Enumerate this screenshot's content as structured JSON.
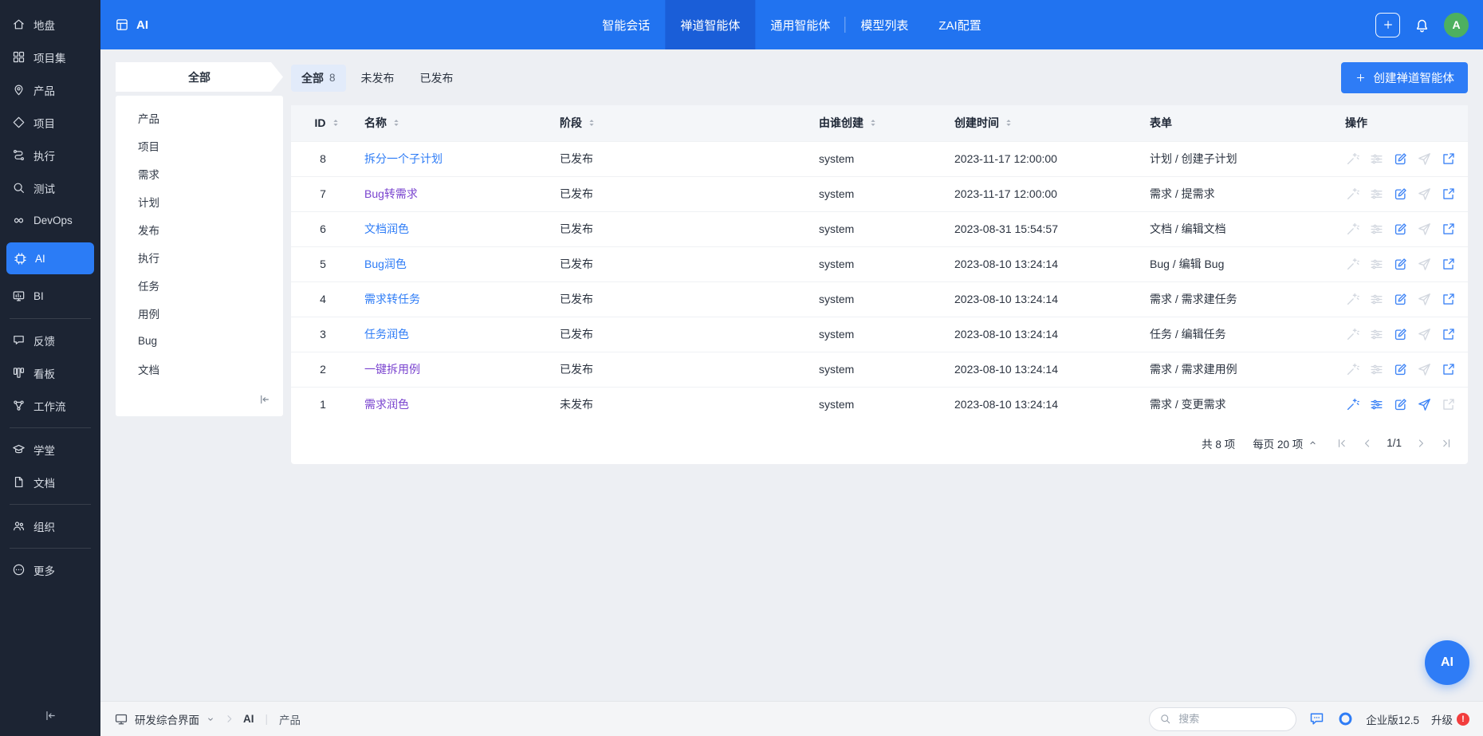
{
  "app": {
    "accent": "#2e7cf6",
    "header_blue": "#2173f0",
    "sidebar_dark": "#1c2433"
  },
  "sidebar": {
    "items": [
      {
        "label": "地盘",
        "icon": "home",
        "name": "sidebar-item-home"
      },
      {
        "label": "项目集",
        "icon": "grid4",
        "name": "sidebar-item-program"
      },
      {
        "label": "产品",
        "icon": "pin",
        "name": "sidebar-item-product"
      },
      {
        "label": "项目",
        "icon": "diamond",
        "name": "sidebar-item-project"
      },
      {
        "label": "执行",
        "icon": "route",
        "name": "sidebar-item-execution"
      },
      {
        "label": "测试",
        "icon": "search",
        "name": "sidebar-item-qa"
      },
      {
        "label": "DevOps",
        "icon": "infinity",
        "name": "sidebar-item-devops"
      },
      {
        "label": "AI",
        "icon": "ai-chip",
        "name": "sidebar-item-ai",
        "active": true
      },
      {
        "label": "BI",
        "icon": "bi",
        "name": "sidebar-item-bi"
      },
      {
        "label": "反馈",
        "icon": "bubble",
        "name": "sidebar-item-feedback",
        "divider_before": true
      },
      {
        "label": "看板",
        "icon": "kanban",
        "name": "sidebar-item-kanban"
      },
      {
        "label": "工作流",
        "icon": "flow",
        "name": "sidebar-item-workflow"
      },
      {
        "label": "学堂",
        "icon": "grad",
        "name": "sidebar-item-learn",
        "divider_before": true
      },
      {
        "label": "文档",
        "icon": "file",
        "name": "sidebar-item-doc"
      },
      {
        "label": "组织",
        "icon": "users",
        "name": "sidebar-item-org",
        "divider_before": true
      },
      {
        "label": "更多",
        "icon": "more",
        "name": "sidebar-item-more",
        "divider_before": true
      }
    ]
  },
  "header": {
    "app_label": "AI",
    "tabs": [
      {
        "label": "智能会话",
        "name": "tab-chat-session"
      },
      {
        "label": "禅道智能体",
        "name": "tab-zentao-agents",
        "active": true
      },
      {
        "label": "通用智能体",
        "name": "tab-general-agents",
        "divider_after": true
      },
      {
        "label": "模型列表",
        "name": "tab-model-list"
      },
      {
        "label": "ZAI配置",
        "name": "tab-zai-config"
      }
    ],
    "avatar_text": "A"
  },
  "filter_panel": {
    "title": "全部",
    "items": [
      {
        "label": "产品",
        "name": "filter-item-product"
      },
      {
        "label": "项目",
        "name": "filter-item-project"
      },
      {
        "label": "需求",
        "name": "filter-item-story"
      },
      {
        "label": "计划",
        "name": "filter-item-plan"
      },
      {
        "label": "发布",
        "name": "filter-item-release"
      },
      {
        "label": "执行",
        "name": "filter-item-execution"
      },
      {
        "label": "任务",
        "name": "filter-item-task"
      },
      {
        "label": "用例",
        "name": "filter-item-case"
      },
      {
        "label": "Bug",
        "name": "filter-item-bug"
      },
      {
        "label": "文档",
        "name": "filter-item-doc"
      }
    ]
  },
  "toolbar": {
    "tabs": [
      {
        "label": "全部",
        "count": "8",
        "active": true,
        "name": "status-tab-all"
      },
      {
        "label": "未发布",
        "name": "status-tab-unpublished"
      },
      {
        "label": "已发布",
        "name": "status-tab-published"
      }
    ],
    "create_button": "创建禅道智能体"
  },
  "table": {
    "columns": [
      {
        "label": "ID"
      },
      {
        "label": "名称"
      },
      {
        "label": "阶段"
      },
      {
        "label": "由谁创建"
      },
      {
        "label": "创建时间"
      },
      {
        "label": "表单"
      },
      {
        "label": "操作"
      }
    ],
    "rows": [
      {
        "id": "8",
        "name": "拆分一个子计划",
        "visited": false,
        "stage": "已发布",
        "creator": "system",
        "created": "2023-11-17 12:00:00",
        "form": "计划 / 创建子计划",
        "actions": {
          "wand": false,
          "config": false,
          "edit": true,
          "send": false,
          "open": true
        }
      },
      {
        "id": "7",
        "name": "Bug转需求",
        "visited": true,
        "stage": "已发布",
        "creator": "system",
        "created": "2023-11-17 12:00:00",
        "form": "需求 / 提需求",
        "actions": {
          "wand": false,
          "config": false,
          "edit": true,
          "send": false,
          "open": true
        }
      },
      {
        "id": "6",
        "name": "文档润色",
        "visited": false,
        "stage": "已发布",
        "creator": "system",
        "created": "2023-08-31 15:54:57",
        "form": "文档 / 编辑文档",
        "actions": {
          "wand": false,
          "config": false,
          "edit": true,
          "send": false,
          "open": true
        }
      },
      {
        "id": "5",
        "name": "Bug润色",
        "visited": false,
        "stage": "已发布",
        "creator": "system",
        "created": "2023-08-10 13:24:14",
        "form": "Bug / 编辑 Bug",
        "actions": {
          "wand": false,
          "config": false,
          "edit": true,
          "send": false,
          "open": true
        }
      },
      {
        "id": "4",
        "name": "需求转任务",
        "visited": false,
        "stage": "已发布",
        "creator": "system",
        "created": "2023-08-10 13:24:14",
        "form": "需求 / 需求建任务",
        "actions": {
          "wand": false,
          "config": false,
          "edit": true,
          "send": false,
          "open": true
        }
      },
      {
        "id": "3",
        "name": "任务润色",
        "visited": false,
        "stage": "已发布",
        "creator": "system",
        "created": "2023-08-10 13:24:14",
        "form": "任务 / 编辑任务",
        "actions": {
          "wand": false,
          "config": false,
          "edit": true,
          "send": false,
          "open": true
        }
      },
      {
        "id": "2",
        "name": "一键拆用例",
        "visited": true,
        "stage": "已发布",
        "creator": "system",
        "created": "2023-08-10 13:24:14",
        "form": "需求 / 需求建用例",
        "actions": {
          "wand": false,
          "config": false,
          "edit": true,
          "send": false,
          "open": true
        }
      },
      {
        "id": "1",
        "name": "需求润色",
        "visited": true,
        "stage": "未发布",
        "creator": "system",
        "created": "2023-08-10 13:24:14",
        "form": "需求 / 变更需求",
        "actions": {
          "wand": true,
          "config": true,
          "edit": true,
          "send": true,
          "open": false
        }
      }
    ],
    "pagination": {
      "total": "共 8 项",
      "page_size": "每页 20 项",
      "page": "1/1"
    }
  },
  "footer": {
    "workspace": "研发综合界面",
    "crumb_app": "AI",
    "crumb_module": "产品",
    "search_placeholder": "搜索",
    "edition": "企业版12.5",
    "upgrade": "升级",
    "upgrade_badge": "!"
  },
  "float_button": {
    "label": "AI"
  }
}
